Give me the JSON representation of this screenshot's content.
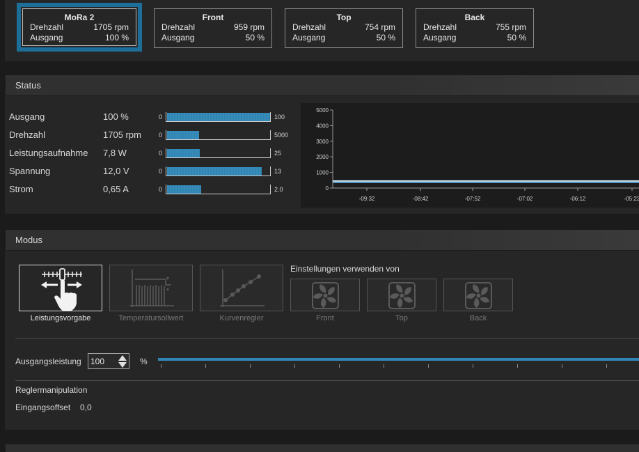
{
  "fans": [
    {
      "name": "MoRa 2",
      "speed_label": "Drehzahl",
      "speed": "1705 rpm",
      "output_label": "Ausgang",
      "output": "100 %"
    },
    {
      "name": "Front",
      "speed_label": "Drehzahl",
      "speed": "959 rpm",
      "output_label": "Ausgang",
      "output": "50 %"
    },
    {
      "name": "Top",
      "speed_label": "Drehzahl",
      "speed": "754 rpm",
      "output_label": "Ausgang",
      "output": "50 %"
    },
    {
      "name": "Back",
      "speed_label": "Drehzahl",
      "speed": "755 rpm",
      "output_label": "Ausgang",
      "output": "50 %"
    }
  ],
  "status": {
    "title": "Status",
    "rows": [
      {
        "label": "Ausgang",
        "value": "100 %",
        "min": "0",
        "max": "100",
        "fraction": 1.0
      },
      {
        "label": "Drehzahl",
        "value": "1705 rpm",
        "min": "0",
        "max": "5000",
        "fraction": 0.31
      },
      {
        "label": "Leistungsaufnahme",
        "value": "7,8 W",
        "min": "0",
        "max": "25",
        "fraction": 0.32
      },
      {
        "label": "Spannung",
        "value": "12,0 V",
        "min": "0",
        "max": "13",
        "fraction": 0.92
      },
      {
        "label": "Strom",
        "value": "0,65 A",
        "min": "0",
        "max": "2.0",
        "fraction": 0.33
      }
    ]
  },
  "chart_data": {
    "type": "line",
    "y_ticks": [
      "5000",
      "4000",
      "3000",
      "2000",
      "1000",
      "0"
    ],
    "x_ticks": [
      "-09:32",
      "-08:42",
      "-07:52",
      "-07:02",
      "-06:12",
      "-05:22"
    ],
    "ylim": [
      0,
      5000
    ],
    "series": [
      {
        "values": [
          100,
          100,
          100,
          100,
          100,
          100
        ],
        "color": "#5fa8d3"
      },
      {
        "values": [
          50,
          50,
          50,
          50,
          50,
          50
        ],
        "color": "#cfe6f3"
      }
    ]
  },
  "mode": {
    "title": "Modus",
    "buttons": [
      {
        "label": "Leistungsvorgabe",
        "active": true
      },
      {
        "label": "Temperatursollwert",
        "active": false
      },
      {
        "label": "Kurvenregler",
        "active": false
      }
    ],
    "sources_title": "Einstellungen verwenden von",
    "sources": [
      {
        "label": "Front"
      },
      {
        "label": "Top"
      },
      {
        "label": "Back"
      }
    ],
    "output_label": "Ausgangsleistung",
    "output_value": "100",
    "output_unit": "%",
    "output_fraction": 1.0,
    "manip_title": "Reglermanipulation",
    "offset_label": "Eingangsoffset",
    "offset_value": "0,0"
  },
  "colors": {
    "accent": "#2f86b4",
    "active_border": "#1e6e9a"
  }
}
